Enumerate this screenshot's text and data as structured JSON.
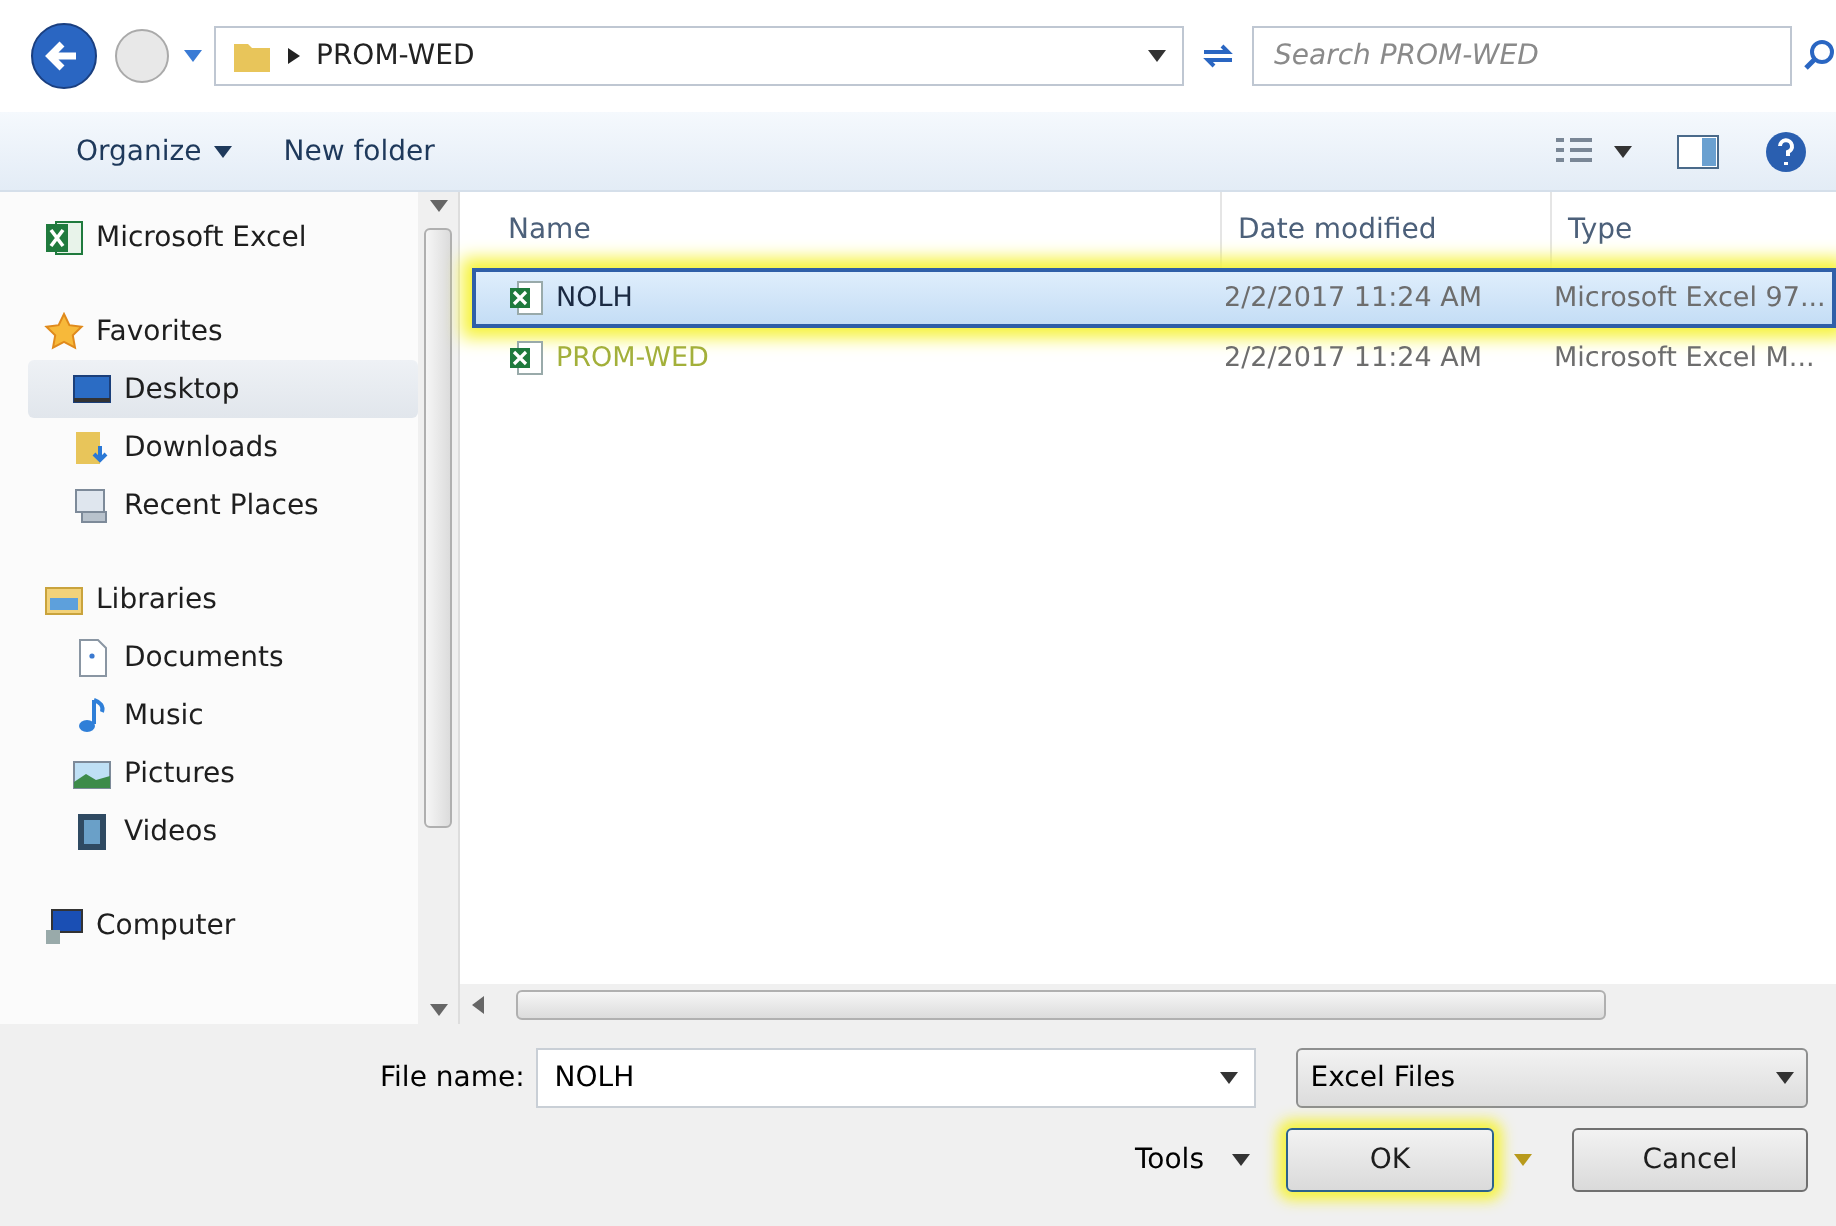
{
  "address_bar": {
    "path": "PROM-WED",
    "search_placeholder": "Search PROM-WED"
  },
  "toolbar": {
    "organize": "Organize",
    "new_folder": "New folder"
  },
  "sidebar": {
    "items": [
      {
        "label": "Microsoft Excel",
        "kind": "excel",
        "selected": false
      },
      {
        "label": "Favorites",
        "kind": "star",
        "selected": false,
        "children": [
          {
            "label": "Desktop",
            "kind": "desktop",
            "selected": true
          },
          {
            "label": "Downloads",
            "kind": "downloads",
            "selected": false
          },
          {
            "label": "Recent Places",
            "kind": "recent",
            "selected": false
          }
        ]
      },
      {
        "label": "Libraries",
        "kind": "library",
        "selected": false,
        "children": [
          {
            "label": "Documents",
            "kind": "documents",
            "selected": false
          },
          {
            "label": "Music",
            "kind": "music",
            "selected": false
          },
          {
            "label": "Pictures",
            "kind": "pictures",
            "selected": false
          },
          {
            "label": "Videos",
            "kind": "videos",
            "selected": false
          }
        ]
      },
      {
        "label": "Computer",
        "kind": "computer",
        "selected": false
      }
    ]
  },
  "file_list": {
    "columns": [
      "Name",
      "Date modified",
      "Type"
    ],
    "rows": [
      {
        "name": "NOLH",
        "date": "2/2/2017 11:24 AM",
        "type": "Microsoft Excel 97...",
        "selected": true
      },
      {
        "name": "PROM-WED",
        "date": "2/2/2017 11:24 AM",
        "type": "Microsoft Excel M...",
        "selected": false
      }
    ]
  },
  "footer": {
    "file_name_label": "File name:",
    "file_name": "NOLH",
    "file_type": "Excel Files",
    "tools": "Tools",
    "ok": "OK",
    "cancel": "Cancel"
  }
}
